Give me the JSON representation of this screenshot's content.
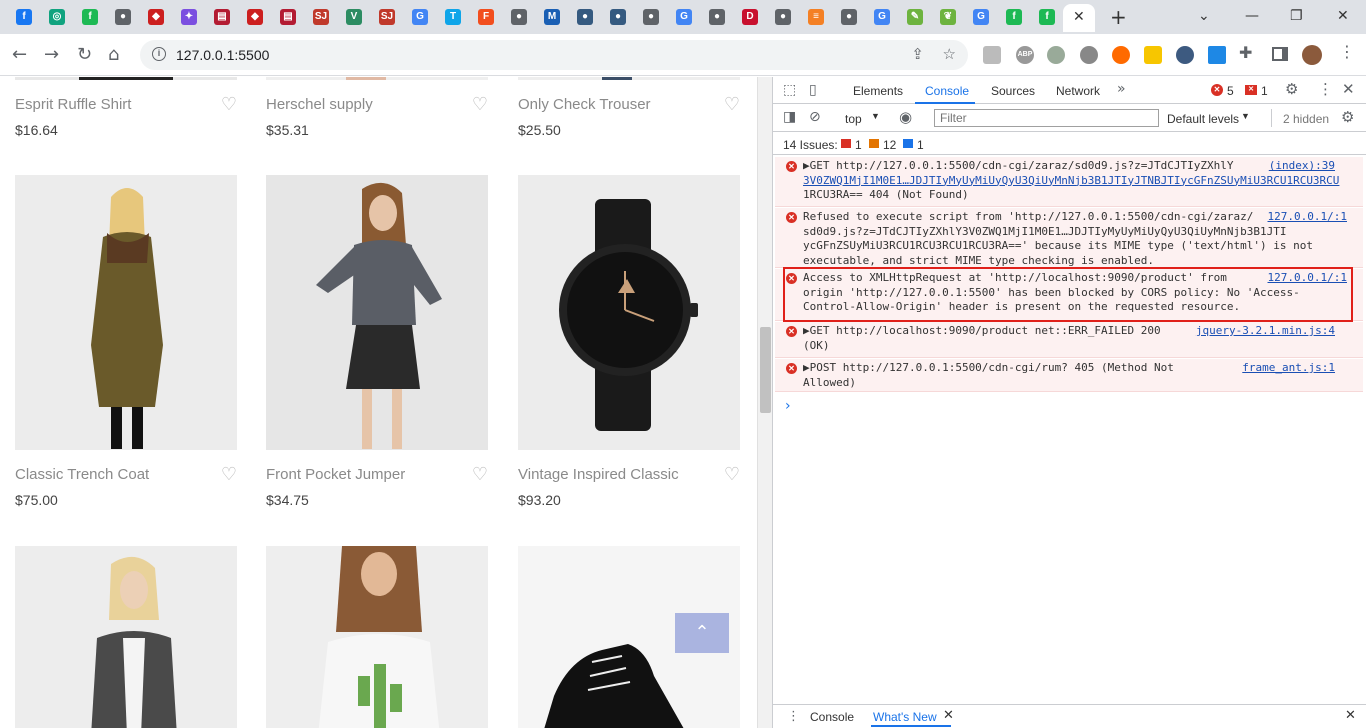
{
  "browser": {
    "tabs": [
      {
        "icon": "facebook-icon",
        "color": "#1877f2",
        "glyph": "f"
      },
      {
        "icon": "chatgpt-icon",
        "color": "#10a37f",
        "glyph": "◎"
      },
      {
        "icon": "freepik-icon",
        "color": "#1db954",
        "glyph": "f"
      },
      {
        "icon": "globe-icon",
        "color": "#5f6368",
        "glyph": "●"
      },
      {
        "icon": "ruby-icon",
        "color": "#cc1f1f",
        "glyph": "◆"
      },
      {
        "icon": "gemini-icon",
        "color": "#7b4fe0",
        "glyph": "✦"
      },
      {
        "icon": "books-icon",
        "color": "#b31b32",
        "glyph": "▤"
      },
      {
        "icon": "ruby-icon",
        "color": "#cc1f1f",
        "glyph": "◆"
      },
      {
        "icon": "books-icon",
        "color": "#b31b32",
        "glyph": "▤"
      },
      {
        "icon": "sj-icon",
        "color": "#c0392b",
        "glyph": "SJ"
      },
      {
        "icon": "vue-icon",
        "color": "#2c8c62",
        "glyph": "V"
      },
      {
        "icon": "sj-icon",
        "color": "#c0392b",
        "glyph": "SJ"
      },
      {
        "icon": "translate-icon",
        "color": "#4285f4",
        "glyph": "G"
      },
      {
        "icon": "tailwind-icon",
        "color": "#0ea5e9",
        "glyph": "T"
      },
      {
        "icon": "figma-icon",
        "color": "#f24e1e",
        "glyph": "F"
      },
      {
        "icon": "chrome-icon",
        "color": "#5f6368",
        "glyph": "●"
      },
      {
        "icon": "mvn-icon",
        "color": "#1a5fb4",
        "glyph": "M"
      },
      {
        "icon": "edge-icon",
        "color": "#355a80",
        "glyph": "●"
      },
      {
        "icon": "edge-icon",
        "color": "#355a80",
        "glyph": "●"
      },
      {
        "icon": "globe-icon",
        "color": "#5f6368",
        "glyph": "●"
      },
      {
        "icon": "google-icon",
        "color": "#4285f4",
        "glyph": "G"
      },
      {
        "icon": "globe-icon",
        "color": "#5f6368",
        "glyph": "●"
      },
      {
        "icon": "dribbble-icon",
        "color": "#c8102e",
        "glyph": "D"
      },
      {
        "icon": "globe-icon",
        "color": "#5f6368",
        "glyph": "●"
      },
      {
        "icon": "stackoverflow-icon",
        "color": "#f48024",
        "glyph": "≡"
      },
      {
        "icon": "chrome-icon",
        "color": "#5f6368",
        "glyph": "●"
      },
      {
        "icon": "google-icon",
        "color": "#4285f4",
        "glyph": "G"
      },
      {
        "icon": "leaf-icon",
        "color": "#6db33f",
        "glyph": "✎"
      },
      {
        "icon": "spring-icon",
        "color": "#6db33f",
        "glyph": "❦"
      },
      {
        "icon": "google-icon",
        "color": "#4285f4",
        "glyph": "G"
      },
      {
        "icon": "freepik-icon",
        "color": "#1db954",
        "glyph": "f"
      },
      {
        "icon": "freepik-icon",
        "color": "#1db954",
        "glyph": "f"
      }
    ],
    "url": "127.0.0.1:5500"
  },
  "products": [
    {
      "name": "Esprit Ruffle Shirt",
      "price": "$16.64"
    },
    {
      "name": "Herschel supply",
      "price": "$35.31"
    },
    {
      "name": "Only Check Trouser",
      "price": "$25.50"
    },
    {
      "name": "Classic Trench Coat",
      "price": "$75.00"
    },
    {
      "name": "Front Pocket Jumper",
      "price": "$34.75"
    },
    {
      "name": "Vintage Inspired Classic",
      "price": "$93.20"
    }
  ],
  "devtools": {
    "tabs": {
      "elements": "Elements",
      "console": "Console",
      "sources": "Sources",
      "network": "Network"
    },
    "error_count": "5",
    "issue_count": "1",
    "context": "top",
    "filter_placeholder": "Filter",
    "levels": "Default levels",
    "hidden": "2 hidden",
    "issues": {
      "label": "14 Issues:",
      "errors": "1",
      "warnings": "12",
      "info": "1"
    },
    "messages": [
      {
        "lines": [
          "▶GET http://127.0.0.1:5500/cdn-cgi/zaraz/sd0d9.js?z=JTdCJTIyZXhlY",
          "3V0ZWQ1MjI1M0E1…JDJTIyMyUyMiUyQyU3QiUyMnNjb3B1JTIyJTNBJTIycGFnZSUyMiU3RCU1RCU3RCU",
          "1RCU3RA== 404 (Not Found)"
        ],
        "source": "(index):39"
      },
      {
        "lines": [
          "Refused to execute script from 'http://127.0.0.1:5500/cdn-cgi/zaraz/",
          "sd0d9.js?z=JTdCJTIyZXhlY3V0ZWQ1MjI1M0E1…JDJTIyMyUyMiUyQyU3QiUyMnNjb3B1JTI",
          "ycGFnZSUyMiU3RCU1RCU3RCU1RCU3RA==' because its MIME type ('text/html') is not",
          "executable, and strict MIME type checking is enabled."
        ],
        "source": "127.0.0.1/:1"
      },
      {
        "lines": [
          "Access to XMLHttpRequest at 'http://localhost:9090/product' from",
          "origin 'http://127.0.0.1:5500' has been blocked by CORS policy: No 'Access-",
          "Control-Allow-Origin' header is present on the requested resource."
        ],
        "source": "127.0.0.1/:1"
      },
      {
        "lines": [
          "▶GET http://localhost:9090/product net::ERR_FAILED 200",
          "(OK)"
        ],
        "source": "jquery-3.2.1.min.js:4"
      },
      {
        "lines": [
          "▶POST http://127.0.0.1:5500/cdn-cgi/rum? 405 (Method Not",
          "Allowed)"
        ],
        "source": "frame_ant.js:1"
      }
    ],
    "drawer": {
      "console": "Console",
      "whats_new": "What's New"
    }
  }
}
